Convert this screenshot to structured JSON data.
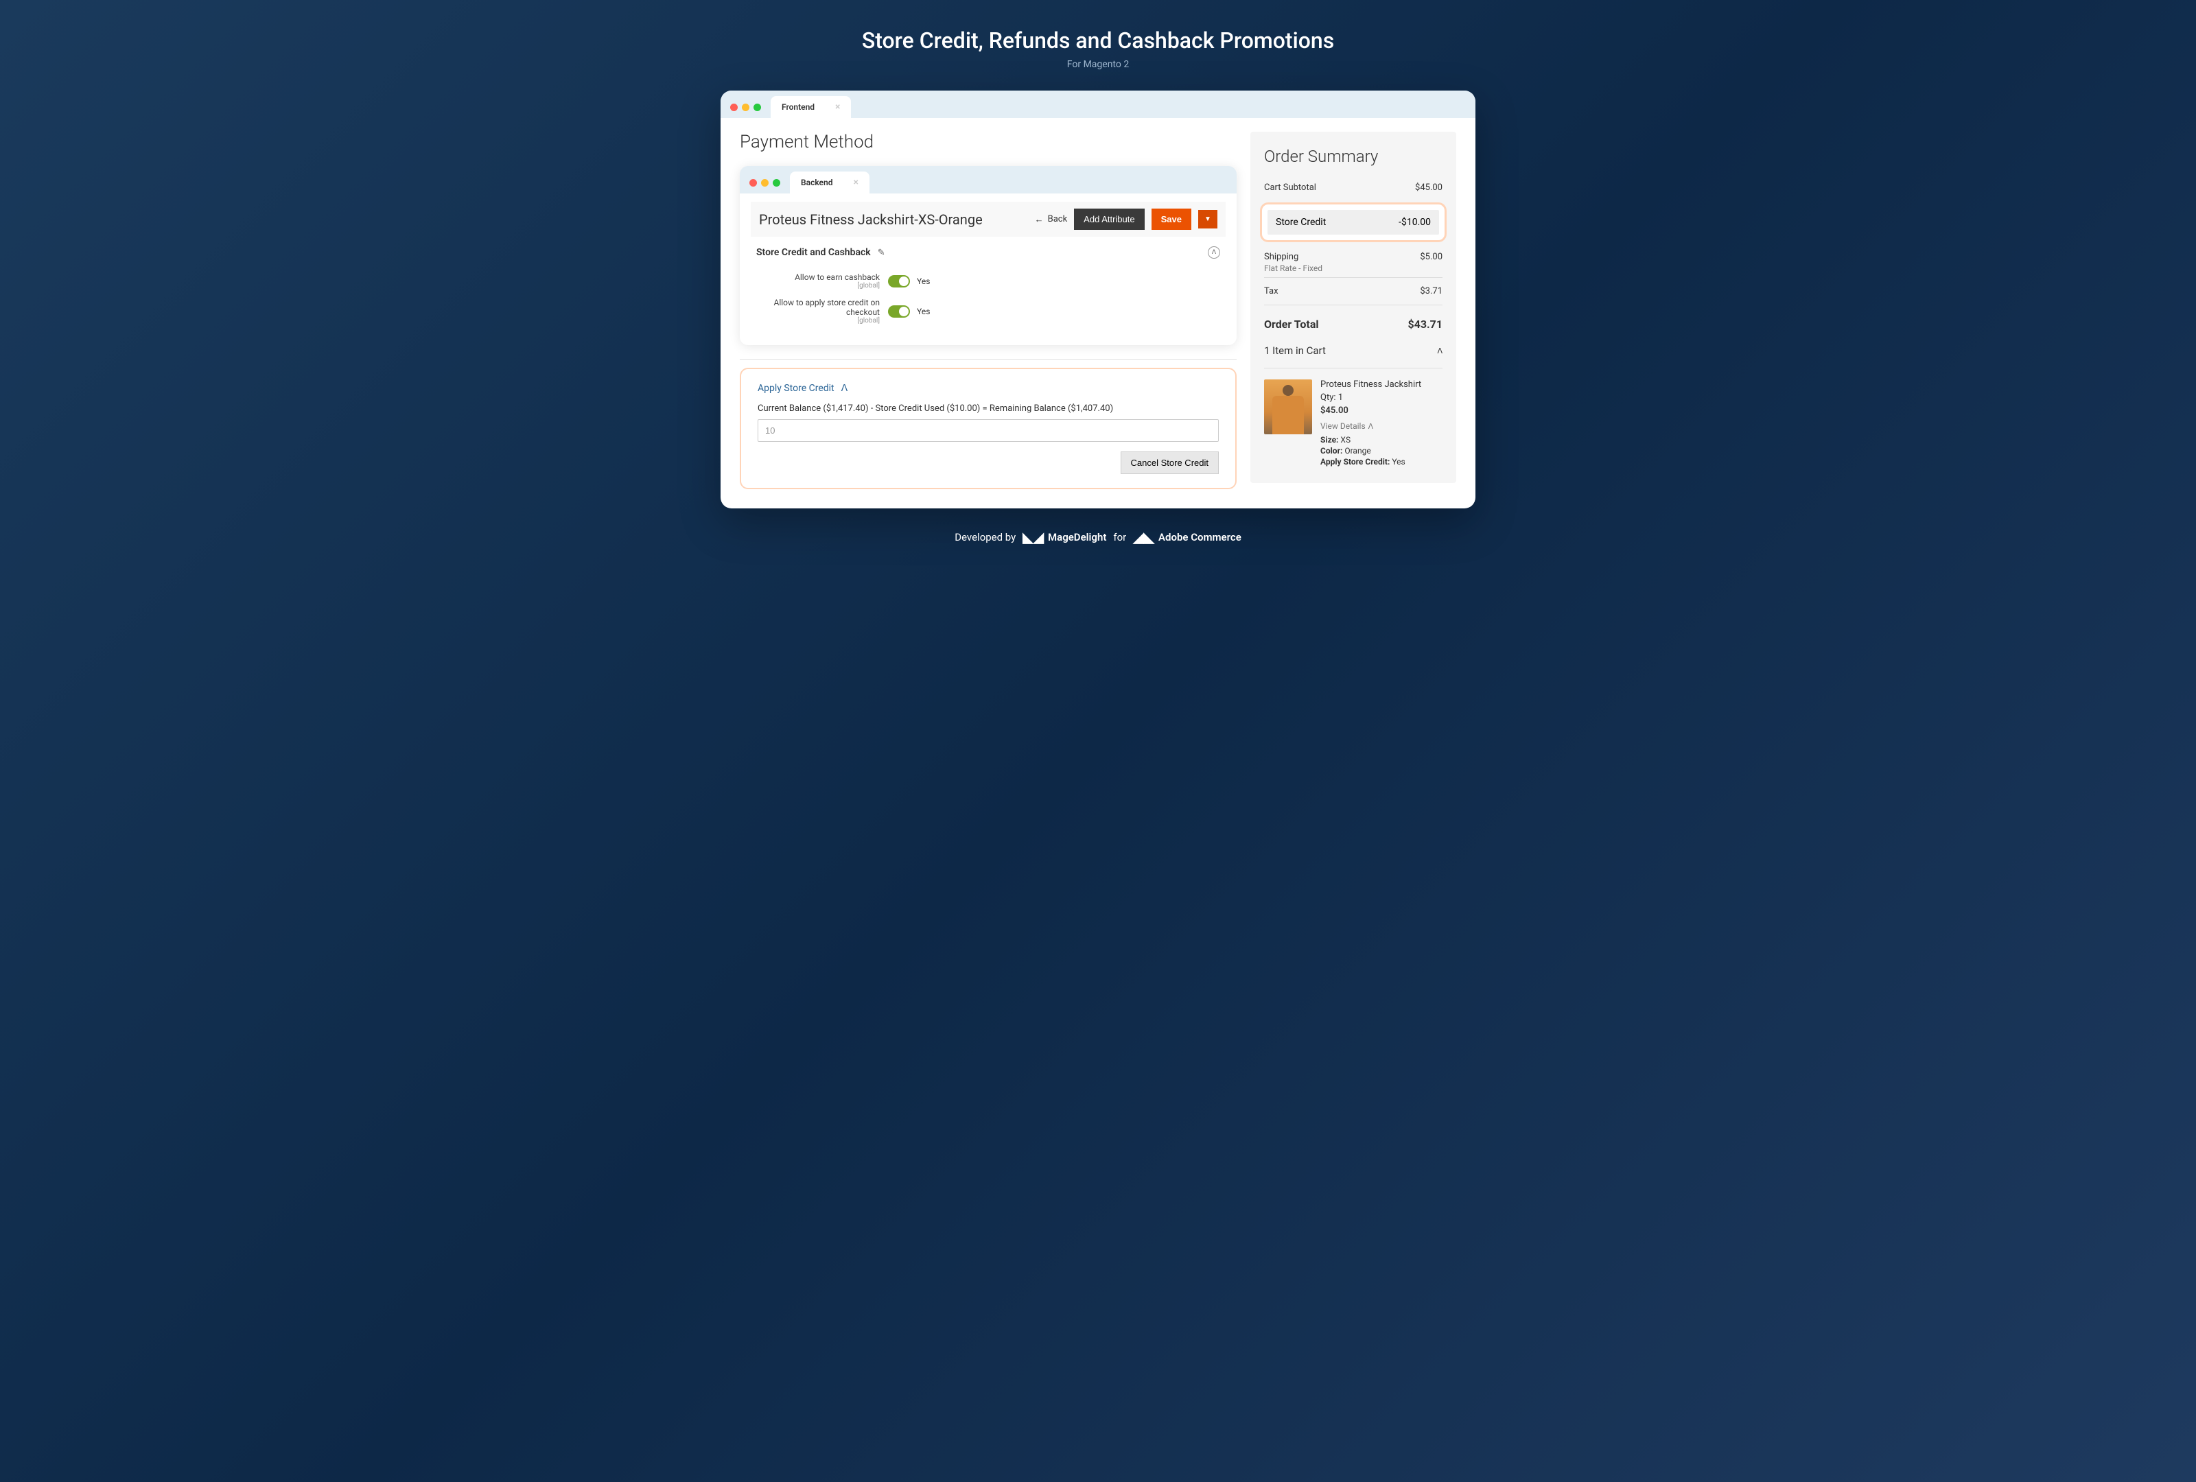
{
  "hero": {
    "title": "Store Credit, Refunds and Cashback Promotions",
    "subtitle": "For Magento 2"
  },
  "outer_tab": {
    "label": "Frontend"
  },
  "page_title": "Payment Method",
  "inner_tab": {
    "label": "Backend"
  },
  "product_header": {
    "title": "Proteus Fitness Jackshirt-XS-Orange",
    "back": "Back",
    "add_attribute": "Add Attribute",
    "save": "Save"
  },
  "section": {
    "title": "Store Credit and Cashback",
    "options": [
      {
        "label": "Allow to earn cashback",
        "scope": "[global]",
        "value": "Yes"
      },
      {
        "label": "Allow to apply store credit on checkout",
        "scope": "[global]",
        "value": "Yes"
      }
    ]
  },
  "apply_credit": {
    "heading": "Apply Store Credit",
    "balance_text": "Current Balance ($1,417.40) - Store Credit Used ($10.00) = Remaining Balance ($1,407.40)",
    "input_value": "10",
    "cancel_label": "Cancel Store Credit"
  },
  "summary": {
    "title": "Order Summary",
    "subtotal_label": "Cart Subtotal",
    "subtotal_value": "$45.00",
    "credit_label": "Store Credit",
    "credit_value": "-$10.00",
    "shipping_label": "Shipping",
    "shipping_value": "$5.00",
    "shipping_desc": "Flat Rate - Fixed",
    "tax_label": "Tax",
    "tax_value": "$3.71",
    "total_label": "Order Total",
    "total_value": "$43.71",
    "items_head": "1 Item in Cart",
    "item": {
      "name": "Proteus Fitness Jackshirt",
      "qty": "Qty: 1",
      "price": "$45.00",
      "view_details": "View Details",
      "size_label": "Size:",
      "size_value": "XS",
      "color_label": "Color:",
      "color_value": "Orange",
      "asc_label": "Apply Store Credit:",
      "asc_value": "Yes"
    }
  },
  "footer": {
    "dev_by": "Developed by",
    "brand1": "MageDelight",
    "for": "for",
    "brand2": "Adobe Commerce"
  }
}
